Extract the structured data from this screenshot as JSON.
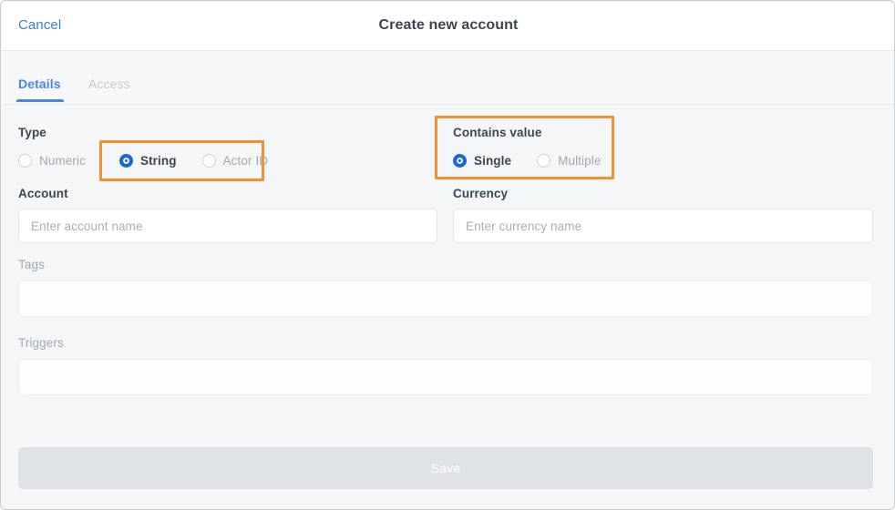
{
  "header": {
    "cancel_label": "Cancel",
    "title": "Create new account"
  },
  "tabs": [
    {
      "label": "Details",
      "active": true
    },
    {
      "label": "Access",
      "active": false
    }
  ],
  "form": {
    "type_group": {
      "label": "Type",
      "options": [
        {
          "label": "Numeric",
          "selected": false
        },
        {
          "label": "String",
          "selected": true
        },
        {
          "label": "Actor ID",
          "selected": false
        }
      ]
    },
    "contains_value_group": {
      "label": "Contains value",
      "options": [
        {
          "label": "Single",
          "selected": true
        },
        {
          "label": "Multiple",
          "selected": false
        }
      ]
    },
    "account_field": {
      "label": "Account",
      "placeholder": "Enter account name",
      "value": ""
    },
    "currency_field": {
      "label": "Currency",
      "placeholder": "Enter currency name",
      "value": ""
    },
    "tags_field": {
      "label": "Tags",
      "value": ""
    },
    "triggers_field": {
      "label": "Triggers",
      "value": ""
    },
    "save_button": {
      "label": "Save"
    }
  },
  "annotations": {
    "accent_color": "#ef9234",
    "highlights": [
      {
        "name": "type-options-highlight"
      },
      {
        "name": "contains-value-highlight"
      }
    ]
  },
  "colors": {
    "accent_blue": "#1767e0",
    "link_blue": "#3b7ddd",
    "tab_blue": "#4a85e8",
    "highlight_orange": "#ef9234",
    "text_dark": "#3d4552",
    "text_muted": "#a2a8b2",
    "page_bg": "#f4f6f8"
  }
}
